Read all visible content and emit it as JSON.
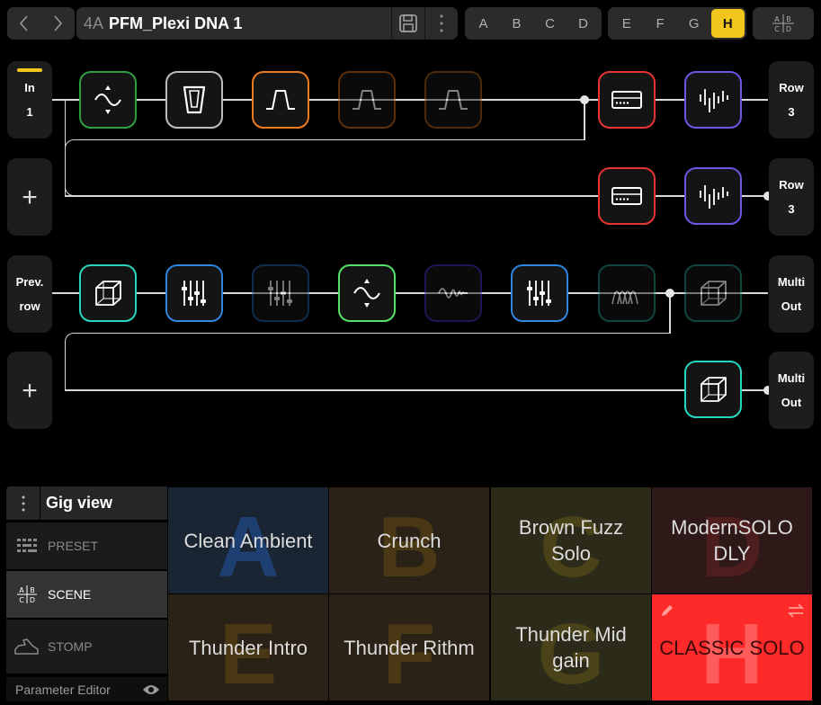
{
  "header": {
    "preset_number": "4A",
    "preset_name": "PFM_Plexi DNA 1",
    "scenes_left": [
      "A",
      "B",
      "C",
      "D"
    ],
    "scenes_right": [
      "E",
      "F",
      "G",
      "H"
    ],
    "active_scene": "H",
    "scene_view_icon": "abcd-grid-icon"
  },
  "chain": {
    "row1": {
      "input_label": "In",
      "input_number": "1",
      "output_label": "Row",
      "output_number": "3",
      "blocks": [
        {
          "type": "filter-icon",
          "color": "#2f9e3f"
        },
        {
          "type": "wah-icon",
          "color": "#bdbdbd"
        },
        {
          "type": "drive-icon",
          "color": "#ec7a1f"
        },
        {
          "type": "drive-icon",
          "color": "#b95e16"
        },
        {
          "type": "drive-icon",
          "color": "#9c5515"
        },
        {
          "type": "amp-icon",
          "color": "#e53434"
        },
        {
          "type": "cab-icon",
          "color": "#6a57e6"
        }
      ]
    },
    "row2": {
      "add_label": "+",
      "output_label": "Row",
      "output_number": "3",
      "blocks": [
        {
          "type": "amp-icon",
          "color": "#e53434"
        },
        {
          "type": "cab-icon",
          "color": "#6a57e6"
        }
      ]
    },
    "row3": {
      "input_label": "Prev.",
      "input_sub": "row",
      "output_label": "Multi",
      "output_sub": "Out",
      "blocks": [
        {
          "type": "reverb-icon",
          "color": "#28d6c0"
        },
        {
          "type": "eq-icon",
          "color": "#2f86e0"
        },
        {
          "type": "eq-icon",
          "color": "#1f5aa0"
        },
        {
          "type": "filter-icon",
          "color": "#55e06b"
        },
        {
          "type": "pitch-icon",
          "color": "#3a2fb0"
        },
        {
          "type": "eq-icon",
          "color": "#2f86e0"
        },
        {
          "type": "modulation-icon",
          "color": "#1f8a7c"
        },
        {
          "type": "reverb-icon",
          "color": "#1f8a7c"
        }
      ]
    },
    "row4": {
      "add_label": "+",
      "output_label": "Multi",
      "output_sub": "Out",
      "blocks": [
        {
          "type": "reverb-icon",
          "color": "#28d6c0"
        }
      ]
    }
  },
  "gig": {
    "title": "Gig view",
    "menu": [
      {
        "label": "PRESET",
        "icon": "preset-list-icon",
        "active": false
      },
      {
        "label": "SCENE",
        "icon": "abcd-grid-icon",
        "active": true
      },
      {
        "label": "STOMP",
        "icon": "stomp-pedal-icon",
        "active": false
      }
    ],
    "parameter_editor": "Parameter Editor",
    "tiles": [
      {
        "letter": "A",
        "name": "Clean Ambient",
        "bg": "#1a2533",
        "ghost": "#1e3f72",
        "text": "#dcdcdc"
      },
      {
        "letter": "B",
        "name": "Crunch",
        "bg": "#2a2216",
        "ghost": "#4a3714",
        "text": "#dcdcdc"
      },
      {
        "letter": "C",
        "name": "Brown Fuzz Solo",
        "bg": "#2c2a18",
        "ghost": "#4a4218",
        "text": "#dcdcdc"
      },
      {
        "letter": "D",
        "name": "ModernSOLO DLY",
        "bg": "#2e1818",
        "ghost": "#4e1d1d",
        "text": "#dcdcdc"
      },
      {
        "letter": "E",
        "name": "Thunder Intro",
        "bg": "#2a2216",
        "ghost": "#4a3714",
        "text": "#dcdcdc"
      },
      {
        "letter": "F",
        "name": "Thunder Rithm",
        "bg": "#2a2216",
        "ghost": "#4a3714",
        "text": "#dcdcdc"
      },
      {
        "letter": "G",
        "name": "Thunder Mid gain",
        "bg": "#2c2a18",
        "ghost": "#4a4218",
        "text": "#dcdcdc"
      },
      {
        "letter": "H",
        "name": "CLASSIC SOLO",
        "bg": "#fe2929",
        "ghost": "#ff5b5b",
        "text": "#3a0a0a",
        "active": true
      }
    ]
  }
}
